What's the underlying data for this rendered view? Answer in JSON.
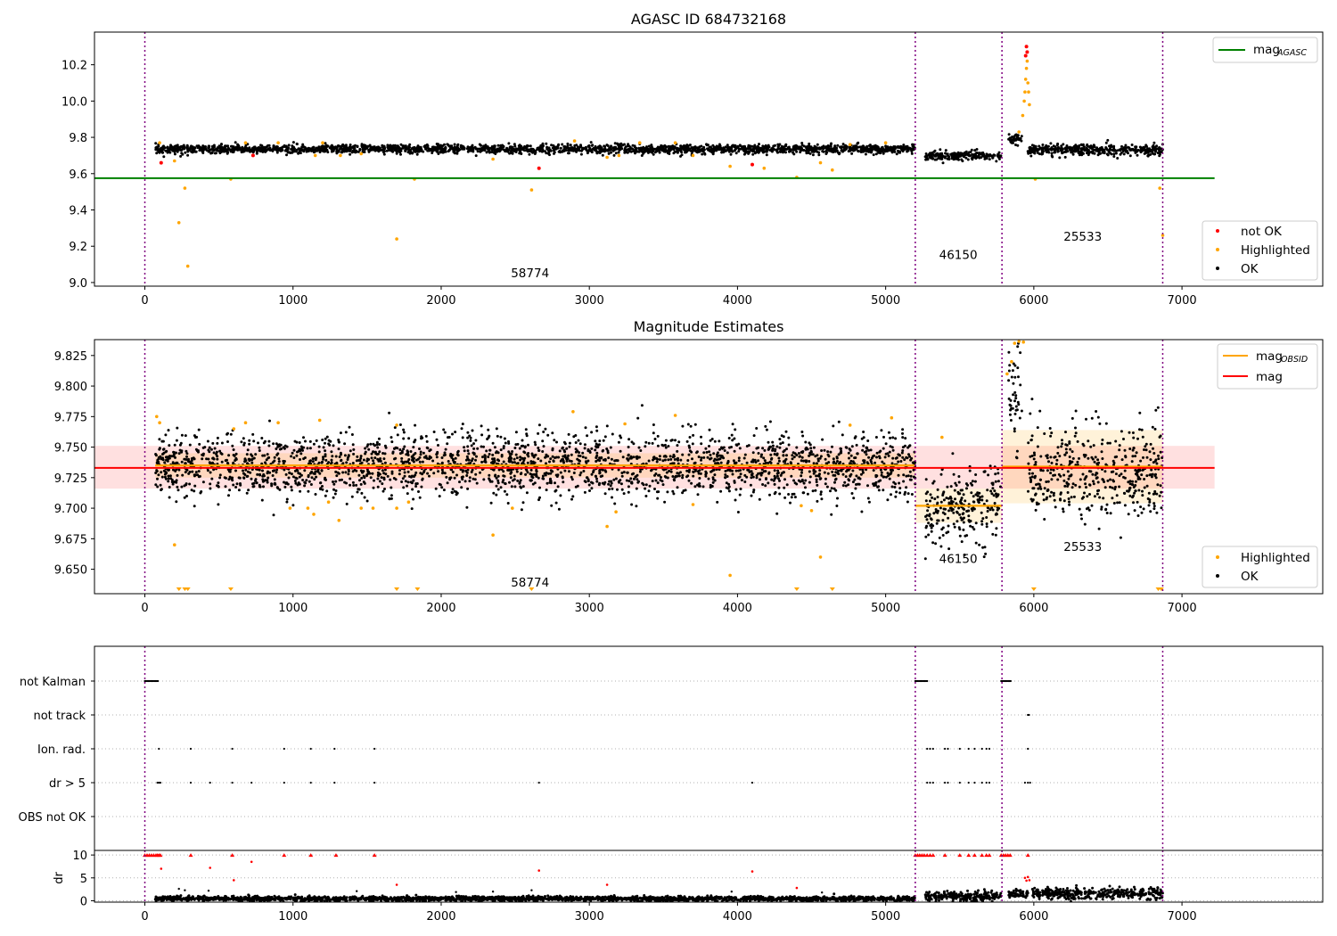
{
  "chart_data": [
    {
      "panel": "agasc",
      "type": "scatter",
      "title": "AGASC ID 684732168",
      "xlabel": "",
      "ylabel": "",
      "xlim": [
        -340,
        7950
      ],
      "ylim": [
        8.98,
        10.38
      ],
      "xticks": [
        0,
        1000,
        2000,
        3000,
        4000,
        5000,
        6000,
        7000
      ],
      "yticks": [
        9.0,
        9.2,
        9.4,
        9.6,
        9.8,
        10.0,
        10.2
      ],
      "grid": false,
      "legend_upper": {
        "position": "top-right",
        "entries": [
          {
            "label": "mag",
            "sub": "AGASC",
            "color": "#008000",
            "kind": "line"
          }
        ]
      },
      "legend_lower": {
        "position": "bottom-right",
        "entries": [
          {
            "label": "not OK",
            "color": "#ff0000",
            "kind": "dot"
          },
          {
            "label": "Highlighted",
            "color": "#ffa500",
            "kind": "dot"
          },
          {
            "label": "OK",
            "color": "#000000",
            "kind": "dot"
          }
        ]
      },
      "hlines": [
        {
          "y": 9.575,
          "x_range": [
            -340,
            7220
          ],
          "color": "#008000",
          "name": "mag_AGASC"
        }
      ],
      "vlines": [
        0,
        5200,
        5785,
        6870
      ],
      "segments_ok": [
        {
          "x_range": [
            70,
            5200
          ],
          "mean": 9.735,
          "spread": 0.012
        },
        {
          "x_range": [
            5265,
            5780
          ],
          "mean": 9.7,
          "spread": 0.012
        },
        {
          "x_range": [
            5830,
            5920
          ],
          "mean": 9.79,
          "spread": 0.015
        },
        {
          "x_range": [
            5960,
            6870
          ],
          "mean": 9.73,
          "spread": 0.015
        }
      ],
      "points_highlighted": [
        [
          100,
          9.77
        ],
        [
          200,
          9.67
        ],
        [
          230,
          9.33
        ],
        [
          270,
          9.52
        ],
        [
          290,
          9.09
        ],
        [
          580,
          9.57
        ],
        [
          680,
          9.77
        ],
        [
          900,
          9.77
        ],
        [
          1150,
          9.7
        ],
        [
          1200,
          9.77
        ],
        [
          1320,
          9.7
        ],
        [
          1460,
          9.71
        ],
        [
          1700,
          9.24
        ],
        [
          1820,
          9.57
        ],
        [
          2350,
          9.68
        ],
        [
          2610,
          9.51
        ],
        [
          2900,
          9.78
        ],
        [
          3120,
          9.69
        ],
        [
          3200,
          9.7
        ],
        [
          3340,
          9.77
        ],
        [
          3580,
          9.77
        ],
        [
          3700,
          9.7
        ],
        [
          3950,
          9.64
        ],
        [
          4180,
          9.63
        ],
        [
          4400,
          9.58
        ],
        [
          4560,
          9.66
        ],
        [
          4640,
          9.62
        ],
        [
          4760,
          9.76
        ],
        [
          5000,
          9.77
        ],
        [
          5900,
          9.83
        ],
        [
          5925,
          9.92
        ],
        [
          5935,
          10.0
        ],
        [
          5940,
          10.05
        ],
        [
          5945,
          10.12
        ],
        [
          5950,
          10.18
        ],
        [
          5955,
          10.22
        ],
        [
          5960,
          10.1
        ],
        [
          5965,
          10.05
        ],
        [
          5970,
          9.98
        ],
        [
          6010,
          9.57
        ],
        [
          6850,
          9.52
        ],
        [
          6870,
          9.26
        ]
      ],
      "points_not_ok": [
        [
          110,
          9.66
        ],
        [
          730,
          9.7
        ],
        [
          2660,
          9.63
        ],
        [
          4100,
          9.65
        ],
        [
          5945,
          10.25
        ],
        [
          5950,
          10.3
        ],
        [
          5955,
          10.27
        ]
      ],
      "annotations": [
        {
          "text": "58774",
          "x": 2600,
          "y": 9.03
        },
        {
          "text": "46150",
          "x": 5490,
          "y": 9.13
        },
        {
          "text": "25533",
          "x": 6330,
          "y": 9.23
        }
      ]
    },
    {
      "panel": "estimates",
      "type": "scatter",
      "title": "Magnitude Estimates",
      "xlabel": "",
      "ylabel": "",
      "xlim": [
        -340,
        7950
      ],
      "ylim": [
        9.63,
        9.838
      ],
      "xticks": [
        0,
        1000,
        2000,
        3000,
        4000,
        5000,
        6000,
        7000
      ],
      "yticks": [
        9.65,
        9.675,
        9.7,
        9.725,
        9.75,
        9.775,
        9.8,
        9.825
      ],
      "grid": false,
      "legend_upper": {
        "position": "top-right",
        "entries": [
          {
            "label": "mag",
            "sub": "OBSID",
            "color": "#ffa500",
            "kind": "line"
          },
          {
            "label": "mag",
            "sub": "",
            "color": "#ff0000",
            "kind": "line"
          }
        ]
      },
      "legend_lower": {
        "position": "bottom-right",
        "entries": [
          {
            "label": "Highlighted",
            "color": "#ffa500",
            "kind": "dot"
          },
          {
            "label": "OK",
            "color": "#000000",
            "kind": "dot"
          }
        ]
      },
      "mag_line": {
        "y": 9.733,
        "band": [
          9.716,
          9.751
        ],
        "x_range": [
          -340,
          7220
        ],
        "color": "#ff0000"
      },
      "obsid_segments": [
        {
          "x_range": [
            70,
            5200
          ],
          "mag": 9.735,
          "band": [
            9.725,
            9.745
          ]
        },
        {
          "x_range": [
            5200,
            5785
          ],
          "mag": 9.702,
          "band": [
            9.688,
            9.716
          ]
        },
        {
          "x_range": [
            5785,
            6870
          ],
          "mag": 9.734,
          "band": [
            9.704,
            9.764
          ]
        }
      ],
      "vlines": [
        0,
        5200,
        5785,
        6870
      ],
      "segments_ok": [
        {
          "x_range": [
            70,
            5200
          ],
          "mean": 9.735,
          "spread": 0.013
        },
        {
          "x_range": [
            5265,
            5780
          ],
          "mean": 9.7,
          "spread": 0.016
        },
        {
          "x_range": [
            5830,
            5920
          ],
          "mean": 9.79,
          "spread": 0.02
        },
        {
          "x_range": [
            5960,
            6870
          ],
          "mean": 9.73,
          "spread": 0.02
        }
      ],
      "points_highlighted": [
        [
          80,
          9.775
        ],
        [
          100,
          9.77
        ],
        [
          200,
          9.67
        ],
        [
          600,
          9.765
        ],
        [
          680,
          9.77
        ],
        [
          900,
          9.77
        ],
        [
          980,
          9.7
        ],
        [
          1100,
          9.7
        ],
        [
          1140,
          9.695
        ],
        [
          1180,
          9.772
        ],
        [
          1240,
          9.705
        ],
        [
          1310,
          9.69
        ],
        [
          1460,
          9.7
        ],
        [
          1540,
          9.7
        ],
        [
          1700,
          9.768
        ],
        [
          1700,
          9.7
        ],
        [
          1780,
          9.705
        ],
        [
          2350,
          9.678
        ],
        [
          2480,
          9.7
        ],
        [
          2890,
          9.779
        ],
        [
          3120,
          9.685
        ],
        [
          3180,
          9.697
        ],
        [
          3240,
          9.769
        ],
        [
          3580,
          9.776
        ],
        [
          3700,
          9.703
        ],
        [
          3950,
          9.645
        ],
        [
          4430,
          9.702
        ],
        [
          4500,
          9.698
        ],
        [
          4560,
          9.66
        ],
        [
          4760,
          9.768
        ],
        [
          5040,
          9.774
        ],
        [
          5380,
          9.758
        ],
        [
          5820,
          9.81
        ],
        [
          5850,
          9.82
        ],
        [
          5870,
          9.835
        ],
        [
          5900,
          9.838
        ],
        [
          5930,
          9.836
        ]
      ],
      "points_below_axis": [
        230,
        270,
        290,
        580,
        1700,
        1840,
        2610,
        4400,
        4640,
        6000,
        6840,
        6860
      ],
      "annotations": [
        {
          "text": "58774",
          "x": 2600,
          "y": 9.636
        },
        {
          "text": "46150",
          "x": 5490,
          "y": 9.655
        },
        {
          "text": "25533",
          "x": 6330,
          "y": 9.665
        }
      ]
    },
    {
      "panel": "flags",
      "type": "scatter",
      "title": "",
      "xlabel": "",
      "ylabel": "",
      "xlim": [
        -340,
        7950
      ],
      "categories": [
        "not Kalman",
        "not track",
        "Ion. rad.",
        "dr > 5",
        "OBS not OK"
      ],
      "grid": true,
      "vlines": [
        0,
        5200,
        5785,
        6870
      ],
      "flag_points": {
        "not Kalman": [
          [
            0,
            90
          ],
          [
            5200,
            5280
          ],
          [
            5780,
            5850
          ]
        ],
        "not track": [
          [
            5960,
            5975
          ]
        ],
        "Ion. rad.": [
          95,
          310,
          590,
          940,
          1120,
          1280,
          1550,
          5280,
          5300,
          5320,
          5400,
          5420,
          5500,
          5560,
          5600,
          5650,
          5680,
          5700,
          5960
        ],
        "dr > 5": [
          85,
          95,
          105,
          310,
          440,
          590,
          720,
          940,
          1120,
          1280,
          1550,
          2660,
          4100,
          5280,
          5300,
          5320,
          5400,
          5420,
          5500,
          5560,
          5600,
          5650,
          5680,
          5700,
          5940,
          5960,
          5975
        ],
        "OBS not OK": []
      }
    },
    {
      "panel": "dr",
      "type": "scatter",
      "title": "",
      "xlabel": "",
      "ylabel": "dr",
      "xlim": [
        -340,
        7950
      ],
      "ylim": [
        -0.3,
        11
      ],
      "xticks": [
        0,
        1000,
        2000,
        3000,
        4000,
        5000,
        6000,
        7000
      ],
      "yticks": [
        0,
        5,
        10
      ],
      "grid": true,
      "vlines": [
        0,
        5200,
        5785,
        6870
      ],
      "segments_ok": [
        {
          "x_range": [
            70,
            5200
          ],
          "mean": 0.45,
          "spread": 0.25
        },
        {
          "x_range": [
            5265,
            5780
          ],
          "mean": 1.0,
          "spread": 0.5
        },
        {
          "x_range": [
            5830,
            5960
          ],
          "mean": 1.6,
          "spread": 0.5
        },
        {
          "x_range": [
            5990,
            6870
          ],
          "mean": 1.6,
          "spread": 0.6
        }
      ],
      "clipped_red_x": [
        0,
        15,
        30,
        45,
        60,
        75,
        85,
        95,
        105,
        310,
        590,
        940,
        1120,
        1290,
        1550,
        5200,
        5215,
        5230,
        5245,
        5260,
        5280,
        5300,
        5320,
        5400,
        5500,
        5560,
        5600,
        5650,
        5680,
        5700,
        5780,
        5795,
        5810,
        5825,
        5840,
        5960
      ],
      "points_red": [
        [
          110,
          7
        ],
        [
          440,
          7.2
        ],
        [
          720,
          8.5
        ],
        [
          2660,
          6.6
        ],
        [
          4100,
          6.4
        ],
        [
          1700,
          3.5
        ],
        [
          3120,
          3.5
        ],
        [
          4400,
          2.8
        ],
        [
          600,
          4.5
        ],
        [
          5940,
          5
        ],
        [
          5950,
          4.4
        ],
        [
          5960,
          5.2
        ],
        [
          5970,
          4.5
        ]
      ],
      "points_black": [
        [
          230,
          2.6
        ],
        [
          270,
          2.3
        ],
        [
          430,
          2.2
        ],
        [
          1430,
          2.1
        ],
        [
          2100,
          1.9
        ],
        [
          2350,
          2.0
        ],
        [
          2610,
          2.3
        ],
        [
          3960,
          2.0
        ],
        [
          4570,
          1.8
        ]
      ]
    }
  ]
}
